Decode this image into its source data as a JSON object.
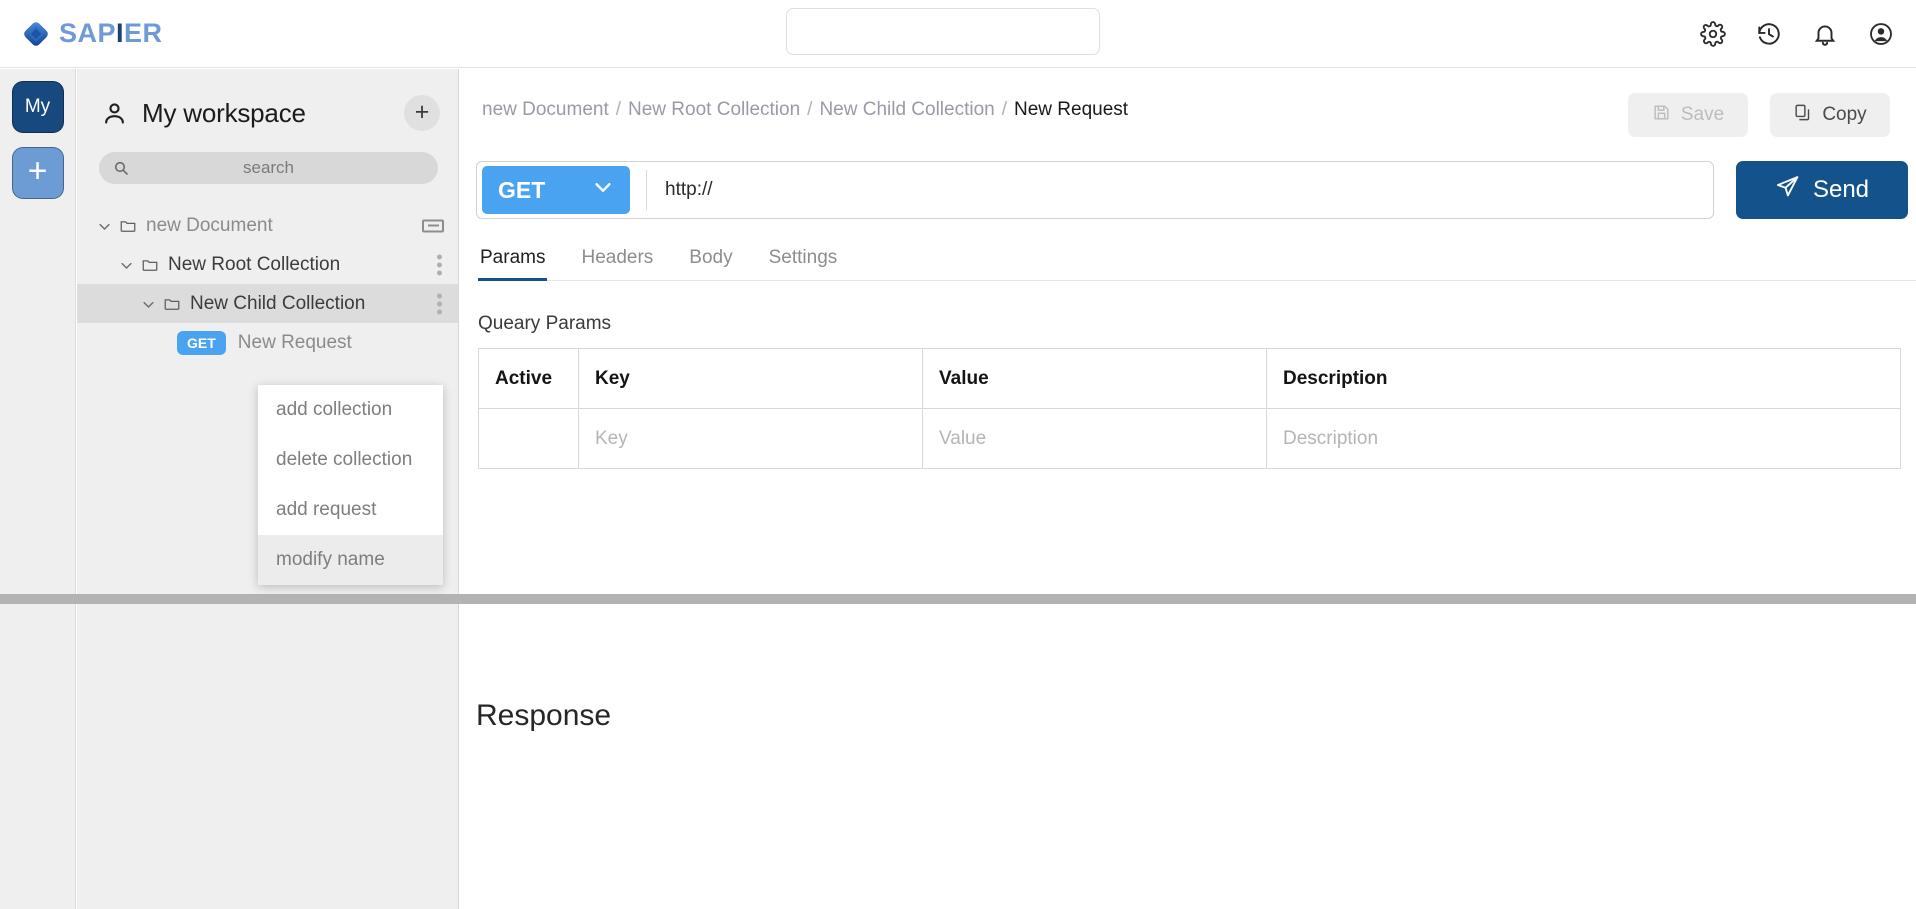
{
  "app": {
    "brand_part1": "SAP",
    "brand_part2": "I",
    "brand_part3": "ER",
    "logo_icon": "diamond-logo-icon",
    "accent_blue": "#4aa3f0",
    "navy": "#14528c",
    "rail_my_bg": "#17487e",
    "rail_add_bg": "#6d9bd4"
  },
  "topbar": {
    "search_value": "",
    "search_placeholder": "",
    "icons": [
      {
        "name": "settings-icon",
        "label": "Settings"
      },
      {
        "name": "history-icon",
        "label": "History"
      },
      {
        "name": "notifications-icon",
        "label": "Notifications"
      },
      {
        "name": "account-icon",
        "label": "Account"
      }
    ]
  },
  "rail": {
    "my_label": "My",
    "add_label": "+"
  },
  "sidebar": {
    "workspace_title": "My workspace",
    "person_icon": "person-icon",
    "add_label": "+",
    "search_placeholder": "search",
    "search_icon": "search-icon",
    "tree": [
      {
        "label": "new Document",
        "level": 0,
        "tone": "light",
        "type": "folder",
        "expanded": true,
        "selected": false,
        "trailing": "collapse"
      },
      {
        "label": "New Root Collection",
        "level": 1,
        "tone": "dark",
        "type": "folder",
        "expanded": true,
        "selected": false,
        "trailing": "kebab"
      },
      {
        "label": "New Child Collection",
        "level": 2,
        "tone": "dark",
        "type": "folder",
        "expanded": true,
        "selected": true,
        "trailing": "kebab"
      },
      {
        "label": "New Request",
        "level": 3,
        "tone": "light",
        "type": "request",
        "method": "GET",
        "expanded": false,
        "selected": false,
        "trailing": "none"
      }
    ]
  },
  "context_menu": {
    "items": [
      {
        "label": "add collection",
        "highlighted": false
      },
      {
        "label": "delete collection",
        "highlighted": false
      },
      {
        "label": "add request",
        "highlighted": false
      },
      {
        "label": "modify name",
        "highlighted": true
      }
    ]
  },
  "main": {
    "breadcrumb": [
      {
        "label": "new Document",
        "current": false
      },
      {
        "label": "New Root Collection",
        "current": false
      },
      {
        "label": "New Child Collection",
        "current": false
      },
      {
        "label": "New Request",
        "current": true
      }
    ],
    "breadcrumb_separator": "/",
    "save_label": "Save",
    "save_icon": "save-icon",
    "save_disabled": true,
    "copy_label": "Copy",
    "copy_icon": "copy-icon",
    "method": "GET",
    "method_chevron": "chevron-down-icon",
    "url_value": "http://",
    "url_placeholder": "http://",
    "send_label": "Send",
    "send_icon": "send-icon",
    "tabs": [
      {
        "label": "Params",
        "active": true
      },
      {
        "label": "Headers",
        "active": false
      },
      {
        "label": "Body",
        "active": false
      },
      {
        "label": "Settings",
        "active": false
      }
    ],
    "params_section_title": "Queary Params",
    "params_columns": [
      "Active",
      "Key",
      "Value",
      "Description"
    ],
    "params_rows": [
      {
        "active": "",
        "key": "",
        "key_placeholder": "Key",
        "value": "",
        "value_placeholder": "Value",
        "description": "",
        "description_placeholder": "Description"
      }
    ],
    "response_title": "Response"
  }
}
